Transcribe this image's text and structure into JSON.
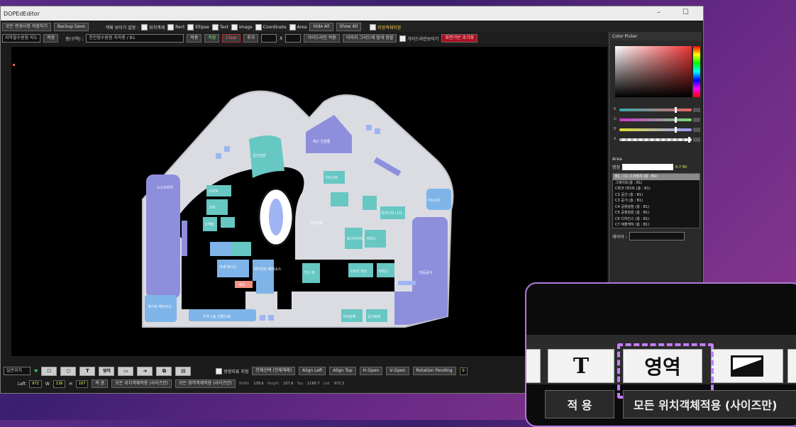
{
  "window": {
    "title": "DOPEdEditor",
    "controls": "–  ☐"
  },
  "toolbar1": {
    "save_all": "모든 변경사항 저장하기",
    "backup": "Backup Save",
    "show_label": "객체 보이기 설정 :",
    "checks": [
      {
        "label": "위치객체",
        "on": true
      },
      {
        "label": "Rect",
        "on": true
      },
      {
        "label": "Ellipse",
        "on": true
      },
      {
        "label": "Text",
        "on": true
      },
      {
        "label": "Image",
        "on": true
      },
      {
        "label": "Coordinate",
        "on": true
      },
      {
        "label": "Area",
        "on": true
      }
    ],
    "hide_all": "Hide All",
    "show_all": "Show All",
    "extra_check": "지정객체지정"
  },
  "toolbar2": {
    "site_select": "지하철수원점 지도",
    "site_btn": "적용",
    "floor_label": "층(구역) :",
    "floor_select": "천안점수원점 지하층 / B1",
    "btn_a": "적용",
    "btn_b": "저장",
    "btn_clear": "Clear",
    "btn_c": "추가",
    "x_label": "X",
    "btn_grid": "가이드라인 적용",
    "btn_grid2": "이미지 그리드에 맞게 정렬",
    "guide_check": "가이드라인보이기",
    "btn_red": "화면기반 초기화"
  },
  "color_picker": {
    "header": "Color Picker",
    "channels": [
      {
        "label": "R",
        "color": "#c04040",
        "pos": 0.78
      },
      {
        "label": "G",
        "color": "#30c050",
        "pos": 0.78
      },
      {
        "label": "B",
        "color": "#4060e0",
        "pos": 0.78
      },
      {
        "label": "A",
        "color": "#dddddd",
        "pos": 0.97
      }
    ]
  },
  "area_panel": {
    "header": "Area",
    "name_label": "명칭",
    "value": "0.7 50",
    "items": [
      "B1 - C1 스크레치 (층 : B1)",
      "그레이트(층 : B1)",
      "C파크 데이트 (층 : B1)",
      "C3 공간 (층 : B1)",
      "C3 공가 (층 : B1)",
      "C4 공항설정 (층 : B1)",
      "C5 공항정원 (층 : B1)",
      "C6 디자인스 (층 : B1)",
      "C7 에플캐쳐 (층 : B1)"
    ],
    "selected_index": 0,
    "layer_label": "레이어 :"
  },
  "bottom1": {
    "mode_select": "일반위치",
    "tools": [
      "☐",
      "○",
      "T",
      "영역",
      "▭",
      "➜",
      "⧉",
      "▤"
    ],
    "check_label": "방향지표 지정",
    "kv": [
      "전체선택 (전체해제)",
      "Align Left",
      "Align Top",
      "H-Open",
      "V-Open",
      "Rotation Pending"
    ],
    "rot_val": "0"
  },
  "bottom2": {
    "left_label": "Left",
    "left_val": "972",
    "w_label": "W",
    "w_val": "139",
    "h_label": "H",
    "h_val": "107",
    "apply": "적 용",
    "apply_all": "모든 위치객체적용 (사이즈만)",
    "apply_all2": "모든 영역객체적용 (사이즈만)",
    "kv": [
      {
        "k": "Width",
        "v": "139.6"
      },
      {
        "k": "Height",
        "v": "107.6"
      },
      {
        "k": "Top",
        "v": "1190.7"
      },
      {
        "k": "Left",
        "v": "972.3"
      }
    ]
  },
  "map": {
    "labels": {
      "a": "스마트",
      "b": "공간감정",
      "c": "에스 인원통",
      "d": "노스브리지",
      "e": "고객",
      "f": "고객장",
      "g": "가세\n테니스",
      "h": "에이전트\n베리소스",
      "i": "기트시트",
      "j": "지하스피 니어",
      "k": "지하설계",
      "l": "로나아웃터",
      "m": "서비스",
      "n": "세요",
      "o": "공간정비",
      "p": "기드 화",
      "q": "대응공식",
      "r": "기트시디",
      "s": "지하 1층 건물이세",
      "t": "계기비\n해커리스",
      "u": "거리센터",
      "v": "서버설계",
      "w": "선세",
      "x": "방문거자",
      "y": "스트다 데스",
      "z": "서비스"
    }
  },
  "callout": {
    "t": "T",
    "area": "영역",
    "apply": "적 용",
    "apply_all": "모든 위치객체적용 (사이즈만)"
  }
}
